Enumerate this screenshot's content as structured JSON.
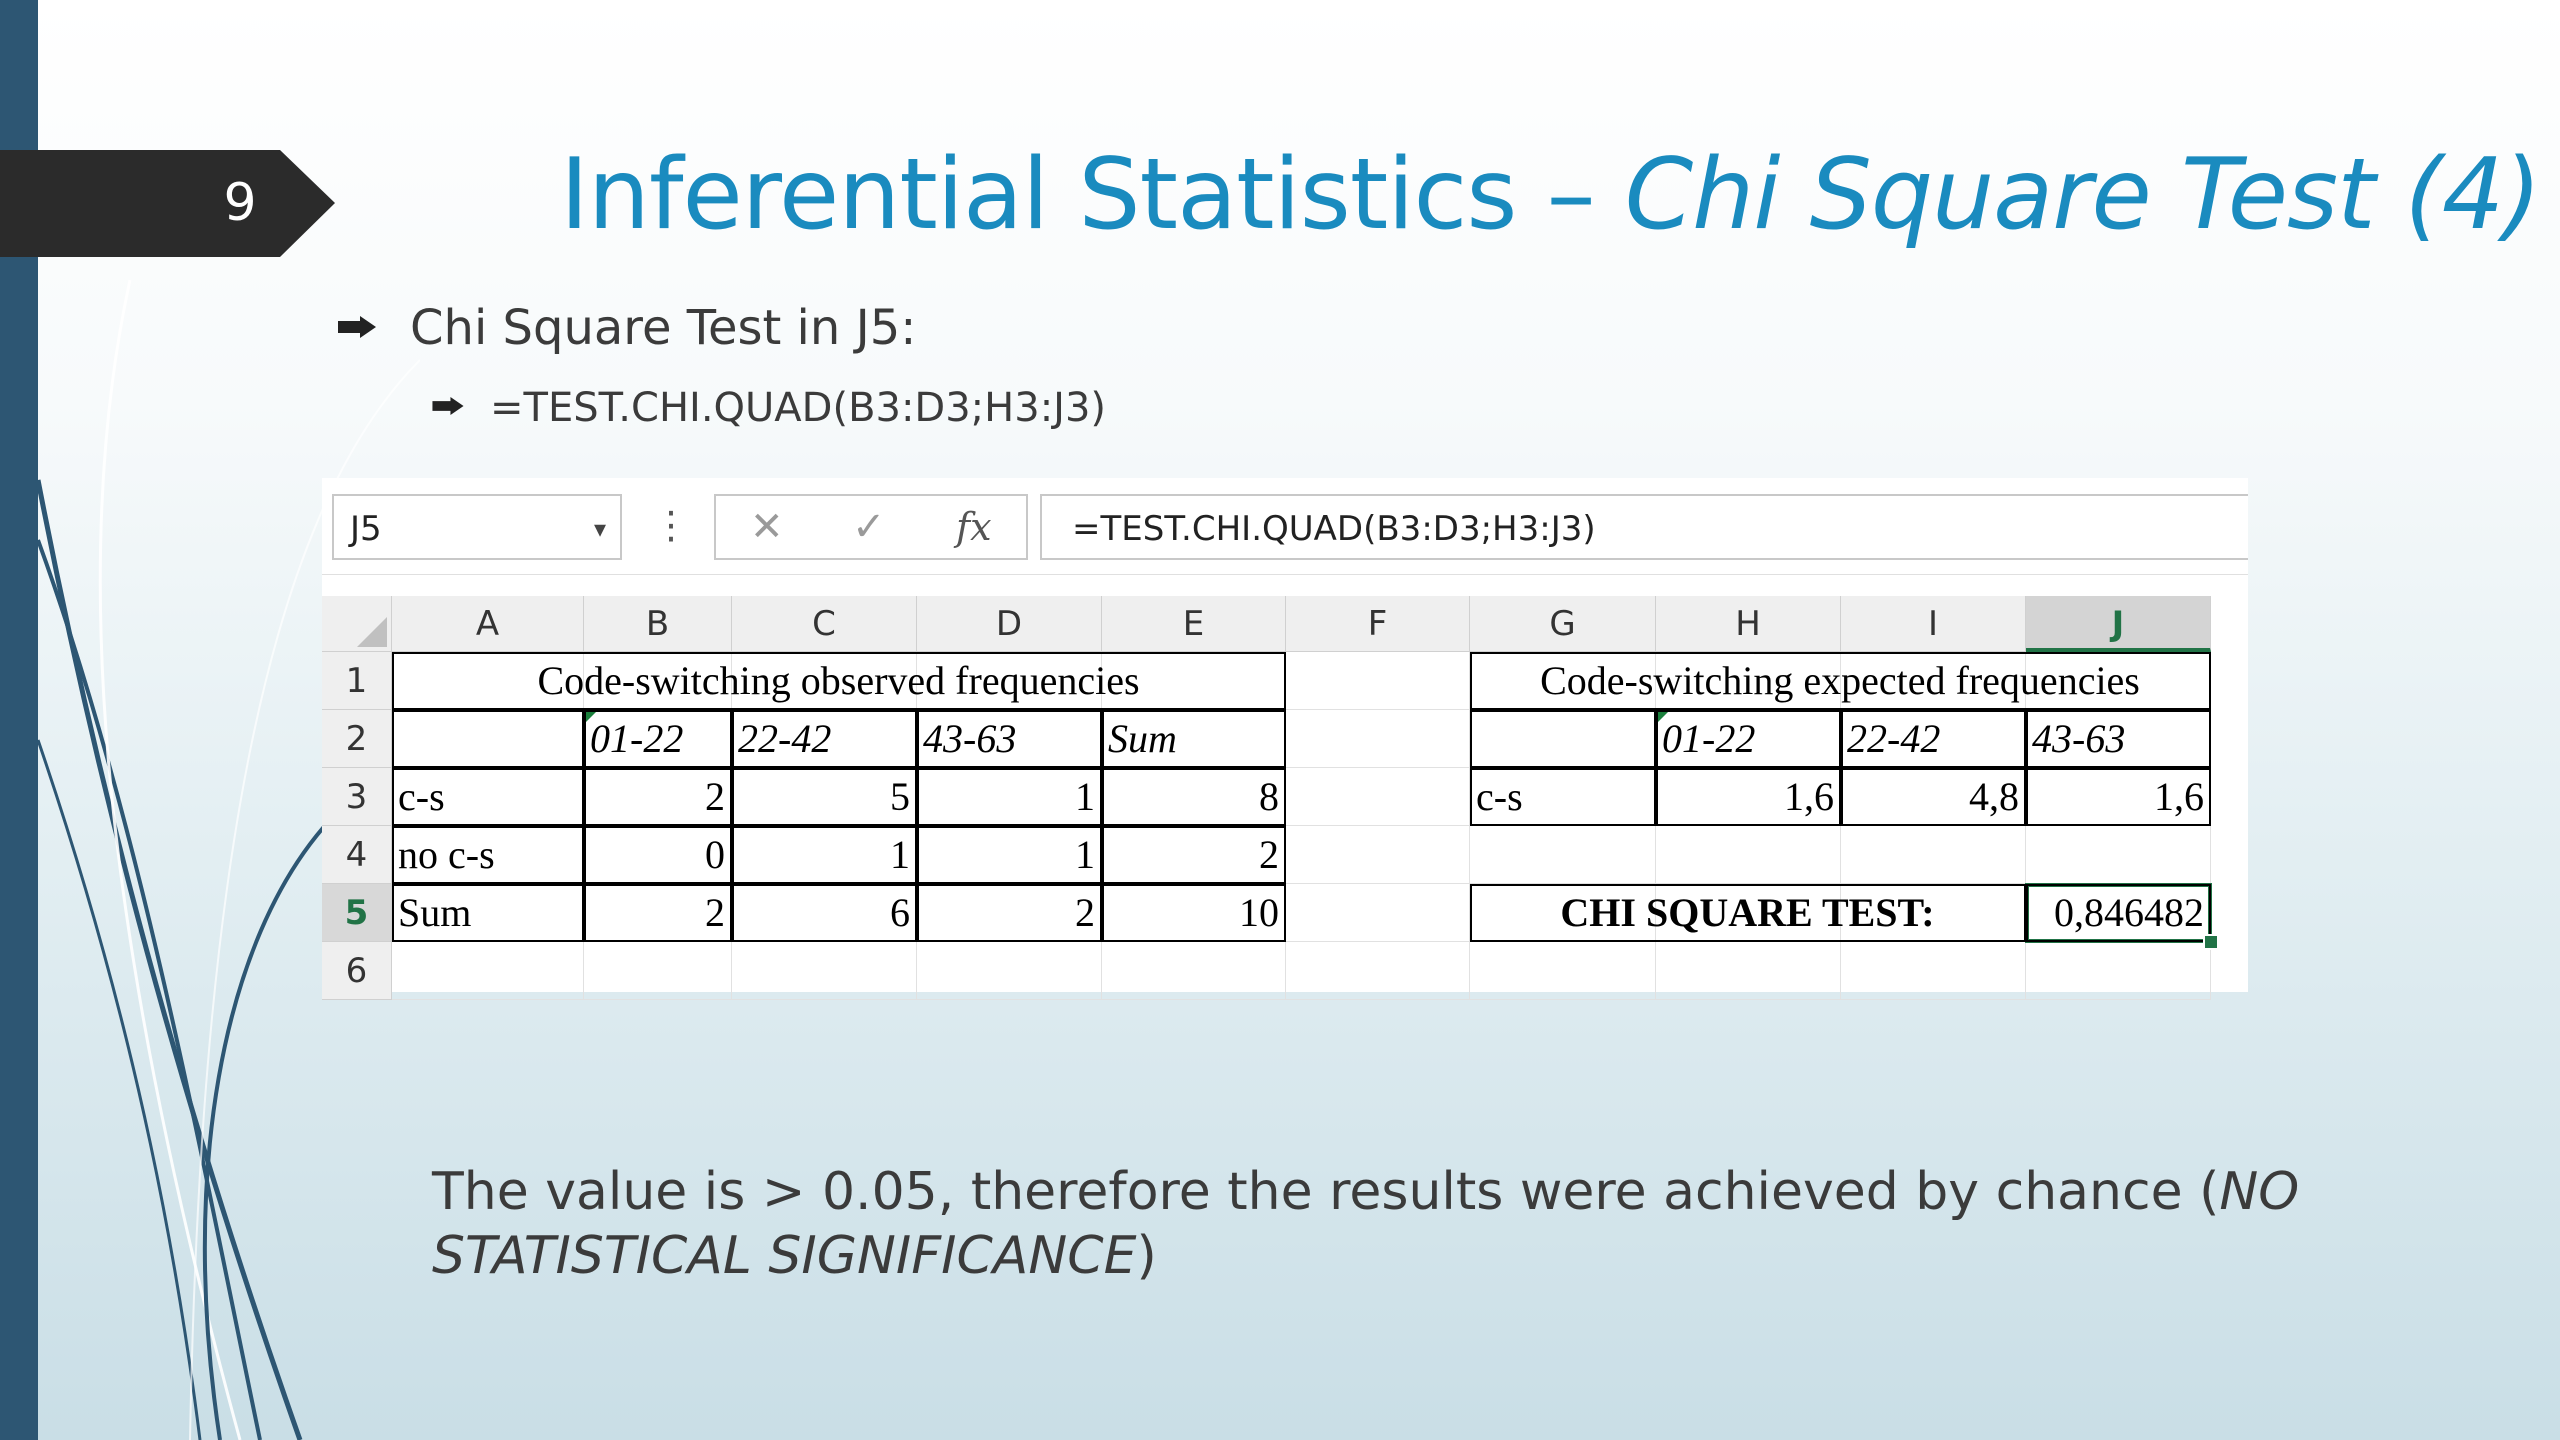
{
  "slide": {
    "number": "9",
    "title_main": "Inferential Statistics – ",
    "title_italic": "Chi Square Test (4)",
    "bullet1": "Chi Square Test in J5:",
    "bullet2": "=TEST.CHI.QUAD(B3:D3;H3:J3)",
    "conclusion_text": "The value is > 0.05, therefore the results were achieved by chance (",
    "conclusion_italic": "NO STATISTICAL SIGNIFICANCE",
    "conclusion_end": ")",
    "colors": {
      "title": "#1a8bbf",
      "left_bar": "#2d5673",
      "tab": "#2b2b2b",
      "excel_green": "#217346"
    }
  },
  "excel": {
    "name_box": "J5",
    "name_box_dropdown": "▾",
    "toolbar_dots": "⋮",
    "cancel_icon": "✕",
    "enter_icon": "✓",
    "fx_icon": "fx",
    "formula": "=TEST.CHI.QUAD(B3:D3;H3:J3)",
    "columns": [
      "A",
      "B",
      "C",
      "D",
      "E",
      "F",
      "G",
      "H",
      "I",
      "J"
    ],
    "rows": [
      "1",
      "2",
      "3",
      "4",
      "5",
      "6"
    ],
    "active_cell": "J5",
    "observed": {
      "title": "Code-switching observed frequencies",
      "headers": [
        "01-22",
        "22-42",
        "43-63",
        "Sum"
      ],
      "rows": [
        {
          "label": "c-s",
          "values": [
            "2",
            "5",
            "1",
            "8"
          ]
        },
        {
          "label": "no c-s",
          "values": [
            "0",
            "1",
            "1",
            "2"
          ]
        },
        {
          "label": "Sum",
          "values": [
            "2",
            "6",
            "2",
            "10"
          ]
        }
      ]
    },
    "expected": {
      "title": "Code-switching expected frequencies",
      "headers": [
        "01-22",
        "22-42",
        "43-63"
      ],
      "row_label": "c-s",
      "values": [
        "1,6",
        "4,8",
        "1,6"
      ],
      "test_label": "CHI SQUARE TEST:",
      "test_value": "0,846482"
    }
  }
}
